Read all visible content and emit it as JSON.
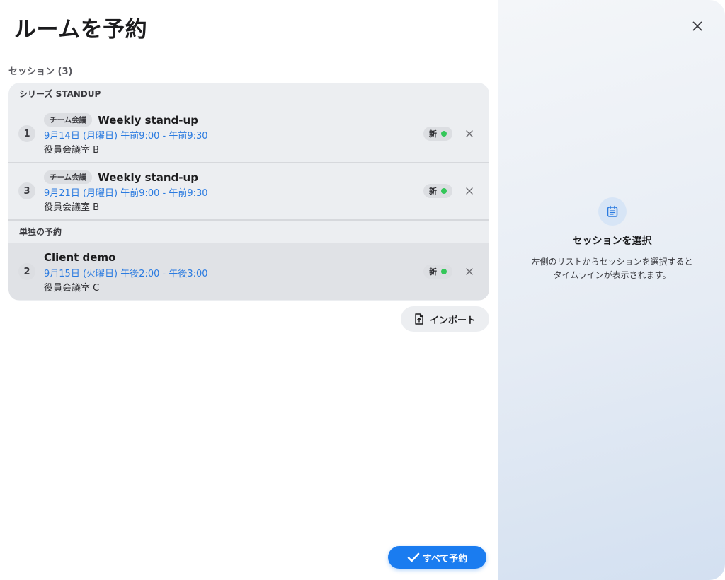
{
  "page": {
    "title": "ルームを予約"
  },
  "sessions": {
    "title": "セッション (3)",
    "groups": [
      {
        "header": "シリーズ STANDUP",
        "items": [
          {
            "number": "1",
            "tag": "チーム会議",
            "title": "Weekly stand-up",
            "time": "9月14日 (月曜日) 午前9:00 - 午前9:30",
            "room": "役員会議室 B",
            "badge": "新"
          },
          {
            "number": "3",
            "tag": "チーム会議",
            "title": "Weekly stand-up",
            "time": "9月21日 (月曜日) 午前9:00 - 午前9:30",
            "room": "役員会議室 B",
            "badge": "新"
          }
        ]
      },
      {
        "header": "単独の予約",
        "items": [
          {
            "number": "2",
            "tag": "",
            "title": "Client demo",
            "time": "9月15日 (火曜日) 午後2:00 - 午後3:00",
            "room": "役員会議室 C",
            "badge": "新"
          }
        ]
      }
    ]
  },
  "actions": {
    "import_label": "インポート",
    "reserve_all_label": "すべて予約"
  },
  "detail": {
    "placeholder_title": "セッションを選択",
    "placeholder_line1": "左側のリストからセッションを選択すると",
    "placeholder_line2": "タイムラインが表示されます。"
  },
  "icons": {
    "close": "close-icon",
    "remove": "close-icon",
    "import": "file-upload-icon",
    "calendar": "calendar-list-icon",
    "check": "checkmark-icon"
  },
  "colors": {
    "accent": "#1a7cf0",
    "time_text": "#2b7be0",
    "status_new": "#34c759"
  }
}
